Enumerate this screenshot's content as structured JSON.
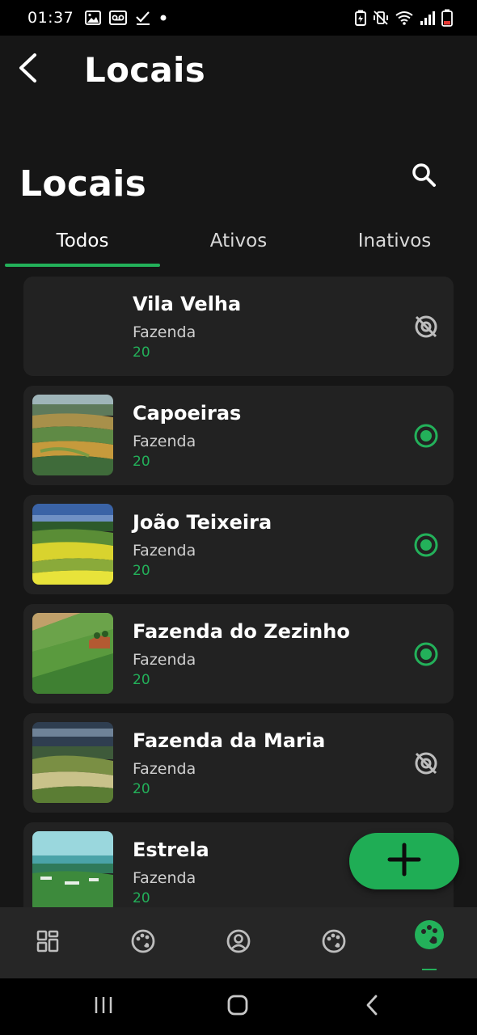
{
  "status_bar": {
    "time": "01:37",
    "left_icons": [
      "gallery-icon",
      "voicemail-icon",
      "check-icon",
      "dot-icon"
    ],
    "right_icons": [
      "battery-saver-icon",
      "vibrate-icon",
      "wifi-icon",
      "signal-icon",
      "battery-icon"
    ]
  },
  "app_bar": {
    "title": "Locais",
    "back_icon": "back-arrow-icon"
  },
  "section": {
    "title": "Locais",
    "search_icon": "search-icon"
  },
  "tabs": [
    {
      "label": "Todos",
      "selected": true
    },
    {
      "label": "Ativos",
      "selected": false
    },
    {
      "label": "Inativos",
      "selected": false
    }
  ],
  "locations": [
    {
      "name": "Vila Velha",
      "type": "Fazenda",
      "count": "20",
      "active": false,
      "image": "none"
    },
    {
      "name": "Capoeiras",
      "type": "Fazenda",
      "count": "20",
      "active": true,
      "image": "farmland-landscape"
    },
    {
      "name": "João Teixeira",
      "type": "Fazenda",
      "count": "20",
      "active": true,
      "image": "yellow-field-landscape"
    },
    {
      "name": "Fazenda do Zezinho",
      "type": "Fazenda",
      "count": "20",
      "active": true,
      "image": "green-field-landscape"
    },
    {
      "name": "Fazenda da Maria",
      "type": "Fazenda",
      "count": "20",
      "active": false,
      "image": "stormy-hills-landscape"
    },
    {
      "name": "Estrela",
      "type": "Fazenda",
      "count": "20",
      "active": true,
      "image": "coastal-landscape"
    }
  ],
  "fab": {
    "icon": "plus-icon"
  },
  "bottom_nav": {
    "items": [
      {
        "icon": "dashboard-icon",
        "active": false
      },
      {
        "icon": "palette-icon",
        "active": false
      },
      {
        "icon": "profile-icon",
        "active": false
      },
      {
        "icon": "palette-icon",
        "active": false
      },
      {
        "icon": "locations-icon",
        "active": true
      }
    ]
  },
  "system_nav": [
    "recents-icon",
    "home-icon",
    "back-icon"
  ],
  "colors": {
    "accent": "#23b15a",
    "background": "#161616",
    "card": "#222222",
    "nav": "#262626",
    "inactive_icon": "#bdbdbd"
  }
}
